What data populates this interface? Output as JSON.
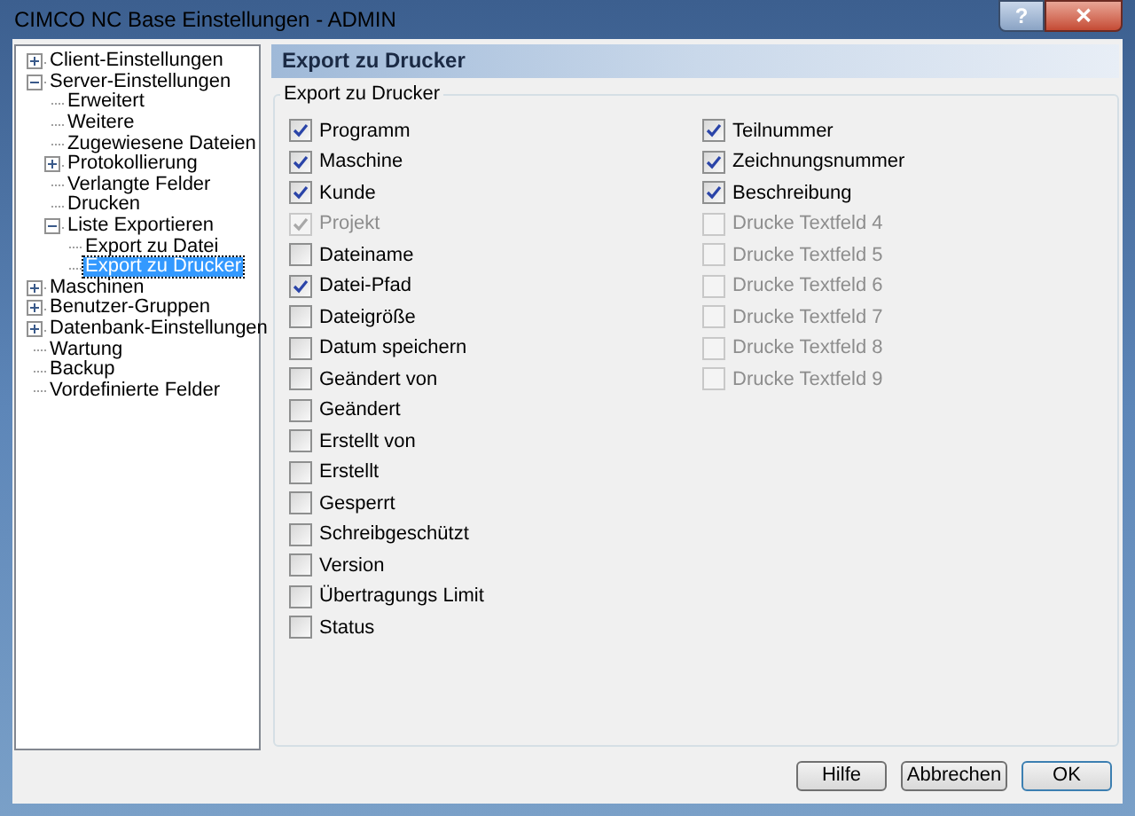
{
  "window": {
    "title": "CIMCO NC Base Einstellungen - ADMIN",
    "buttons": [
      "?",
      "✕"
    ]
  },
  "tree": [
    {
      "label": "Client-Einstellungen",
      "expanded": false,
      "selected": false
    },
    {
      "label": "Server-Einstellungen",
      "expanded": true,
      "selected": false,
      "children": [
        {
          "label": "Erweitert",
          "selected": false
        },
        {
          "label": "Weitere",
          "selected": false
        },
        {
          "label": "Zugewiesene Dateien",
          "selected": false
        },
        {
          "label": "Protokollierung",
          "expanded": false,
          "selected": false
        },
        {
          "label": "Verlangte Felder",
          "selected": false
        },
        {
          "label": "Drucken",
          "selected": false
        },
        {
          "label": "Liste Exportieren",
          "expanded": true,
          "selected": false,
          "children": [
            {
              "label": "Export zu Datei",
              "selected": false
            },
            {
              "label": "Export zu Drucker",
              "selected": true
            }
          ]
        }
      ]
    },
    {
      "label": "Maschinen",
      "expanded": false,
      "selected": false
    },
    {
      "label": "Benutzer-Gruppen",
      "expanded": false,
      "selected": false
    },
    {
      "label": "Datenbank-Einstellungen",
      "expanded": false,
      "selected": false
    },
    {
      "label": "Wartung",
      "selected": false
    },
    {
      "label": "Backup",
      "selected": false
    },
    {
      "label": "Vordefinierte Felder",
      "selected": false
    }
  ],
  "panel": {
    "title": "Export zu Drucker",
    "group": "Export zu Drucker",
    "columns": [
      [
        {
          "label": "Programm",
          "checked": true,
          "disabled": false
        },
        {
          "label": "Maschine",
          "checked": true,
          "disabled": false
        },
        {
          "label": "Kunde",
          "checked": true,
          "disabled": false
        },
        {
          "label": "Projekt",
          "checked": true,
          "disabled": true
        },
        {
          "label": "Dateiname",
          "checked": false,
          "disabled": false
        },
        {
          "label": "Datei-Pfad",
          "checked": true,
          "disabled": false
        },
        {
          "label": "Dateigröße",
          "checked": false,
          "disabled": false
        },
        {
          "label": "Datum speichern",
          "checked": false,
          "disabled": false
        },
        {
          "label": "Geändert von",
          "checked": false,
          "disabled": false
        },
        {
          "label": "Geändert",
          "checked": false,
          "disabled": false
        },
        {
          "label": "Erstellt von",
          "checked": false,
          "disabled": false
        },
        {
          "label": "Erstellt",
          "checked": false,
          "disabled": false
        },
        {
          "label": "Gesperrt",
          "checked": false,
          "disabled": false
        },
        {
          "label": "Schreibgeschützt",
          "checked": false,
          "disabled": false
        },
        {
          "label": "Version",
          "checked": false,
          "disabled": false
        },
        {
          "label": "Übertragungs Limit",
          "checked": false,
          "disabled": false
        },
        {
          "label": "Status",
          "checked": false,
          "disabled": false
        }
      ],
      [
        {
          "label": "Teilnummer",
          "checked": true,
          "disabled": false
        },
        {
          "label": "Zeichnungsnummer",
          "checked": true,
          "disabled": false
        },
        {
          "label": "Beschreibung",
          "checked": true,
          "disabled": false
        },
        {
          "label": "Drucke Textfeld 4",
          "checked": false,
          "disabled": true
        },
        {
          "label": "Drucke Textfeld 5",
          "checked": false,
          "disabled": true
        },
        {
          "label": "Drucke Textfeld 6",
          "checked": false,
          "disabled": true
        },
        {
          "label": "Drucke Textfeld 7",
          "checked": false,
          "disabled": true
        },
        {
          "label": "Drucke Textfeld 8",
          "checked": false,
          "disabled": true
        },
        {
          "label": "Drucke Textfeld 9",
          "checked": false,
          "disabled": true
        }
      ]
    ]
  },
  "buttons": [
    {
      "label": "Hilfe",
      "default": false
    },
    {
      "label": "Abbrechen",
      "default": false
    },
    {
      "label": "OK",
      "default": true
    }
  ]
}
